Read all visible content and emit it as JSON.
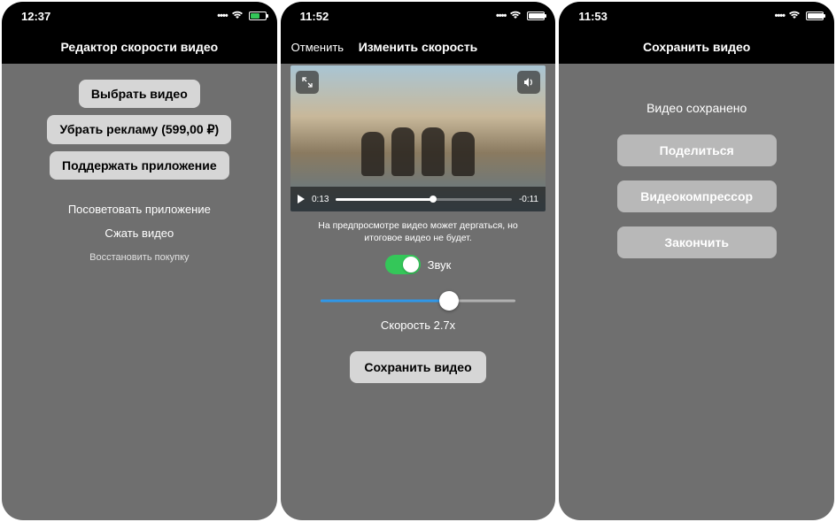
{
  "screen1": {
    "status_time": "12:37",
    "title": "Редактор скорости видео",
    "select_video": "Выбрать видео",
    "remove_ads": "Убрать рекламу (599,00 ₽)",
    "support_app": "Поддержать приложение",
    "recommend": "Посоветовать приложение",
    "compress": "Сжать видео",
    "restore": "Восстановить покупку"
  },
  "screen2": {
    "status_time": "11:52",
    "cancel": "Отменить",
    "title": "Изменить скорость",
    "elapsed": "0:13",
    "remaining": "-0:11",
    "hint": "На предпросмотре видео может дергаться, но итоговое видео не будет.",
    "sound_label": "Звук",
    "speed_label": "Скорость 2.7x",
    "save_video": "Сохранить видео"
  },
  "screen3": {
    "status_time": "11:53",
    "title": "Сохранить видео",
    "saved": "Видео сохранено",
    "share": "Поделиться",
    "compressor": "Видеокомпрессор",
    "finish": "Закончить"
  }
}
